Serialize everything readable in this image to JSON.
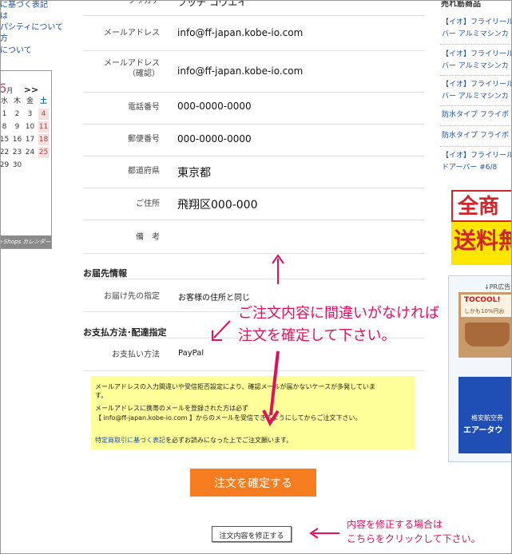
{
  "left_sidebar": {
    "links": [
      "に基づく表記",
      "は",
      "パシティについて",
      "方",
      "について"
    ],
    "calendar": {
      "month_number": "6",
      "month_suffix": "月",
      "next_label": ">>",
      "weekdays": [
        "水",
        "木",
        "金",
        "土"
      ],
      "rows": [
        [
          "",
          "",
          "",
          "",
          ""
        ],
        [
          "1",
          "2",
          "3",
          "4"
        ],
        [
          "8",
          "9",
          "10",
          "11"
        ],
        [
          "15",
          "16",
          "17",
          "18"
        ],
        [
          "22",
          "23",
          "24",
          "25"
        ],
        [
          "29",
          "30",
          "",
          ""
        ]
      ],
      "footer": "e-Shops カレンダー"
    }
  },
  "form": {
    "top_partial_label": "フリガナ",
    "top_partial_value": "フッチ コウエイ",
    "rows": [
      {
        "label": "メールアドレス",
        "value": "info@ff-japan.kobe-io.com"
      },
      {
        "label": "メールアドレス\n（確認）",
        "value": "info@ff-japan.kobe-io.com"
      },
      {
        "label": "電話番号",
        "value": "000-0000-0000"
      },
      {
        "label": "郵便番号",
        "value": "000-0000-0000"
      },
      {
        "label": "都道府県",
        "value": "東京都"
      },
      {
        "label": "ご住所",
        "value": "飛翔区000-000"
      },
      {
        "label": "備　考",
        "value": ""
      }
    ],
    "delivery": {
      "title": "お届先情報",
      "label": "お届け先の指定",
      "value": "お客様の住所と同じ"
    },
    "payment": {
      "title": "お支払方法･配達指定",
      "label": "お支払い方法",
      "value": "PayPal"
    }
  },
  "notice": {
    "line1": "メールアドレスの入力間違いや受信拒否設定により、確認メールが届かないケースが多発していま",
    "line2": "す。",
    "line3": "メールアドレスに携帯のメールを登録された方は必ず",
    "line4": "【 info@ff-japan.kobe-io.com 】からのメールを受信できるようにしてからご注文下さい。",
    "link_text": "特定商取引に基づく表記",
    "line5_rest": "を必ずお読みになった上でご注文願います。"
  },
  "buttons": {
    "confirm": "注文を確定する",
    "edit": "注文内容を修正する"
  },
  "annotations": {
    "main_line1": "ご注文内容に間違いがなければ",
    "main_line2": "注文を確定して下さい。",
    "edit_line1": "内容を修正する場合は",
    "edit_line2": "こちらをクリックして下さい。"
  },
  "right_sidebar": {
    "header": "売れ筋商品",
    "links": [
      [
        "【イオ】フライリール",
        "バー アルミマシンカ"
      ],
      [
        "【イオ】フライリール",
        "バー アルミマシンカ"
      ],
      [
        "【イオ】フライリール",
        "バー アルミマシンカ"
      ],
      [
        "防水タイプ フライボ"
      ],
      [
        "防水タイプ フライボ"
      ],
      [
        "【イオ】フライリール",
        "ドアーバー #6/8"
      ]
    ],
    "banner": {
      "line1": "全商",
      "line2": "送料無"
    },
    "ad_label": "↓PR広告",
    "ad1": {
      "line1": "TOCOOL!",
      "line2": "しかも10%円お"
    },
    "ad2": {
      "line1": "格安航空券",
      "line2": "エアータウ"
    }
  },
  "colors": {
    "accent_orange": "#f57d1f",
    "annotation_pink": "#e0105f",
    "notice_yellow": "#ffff99",
    "link_blue": "#1a4fa8"
  }
}
